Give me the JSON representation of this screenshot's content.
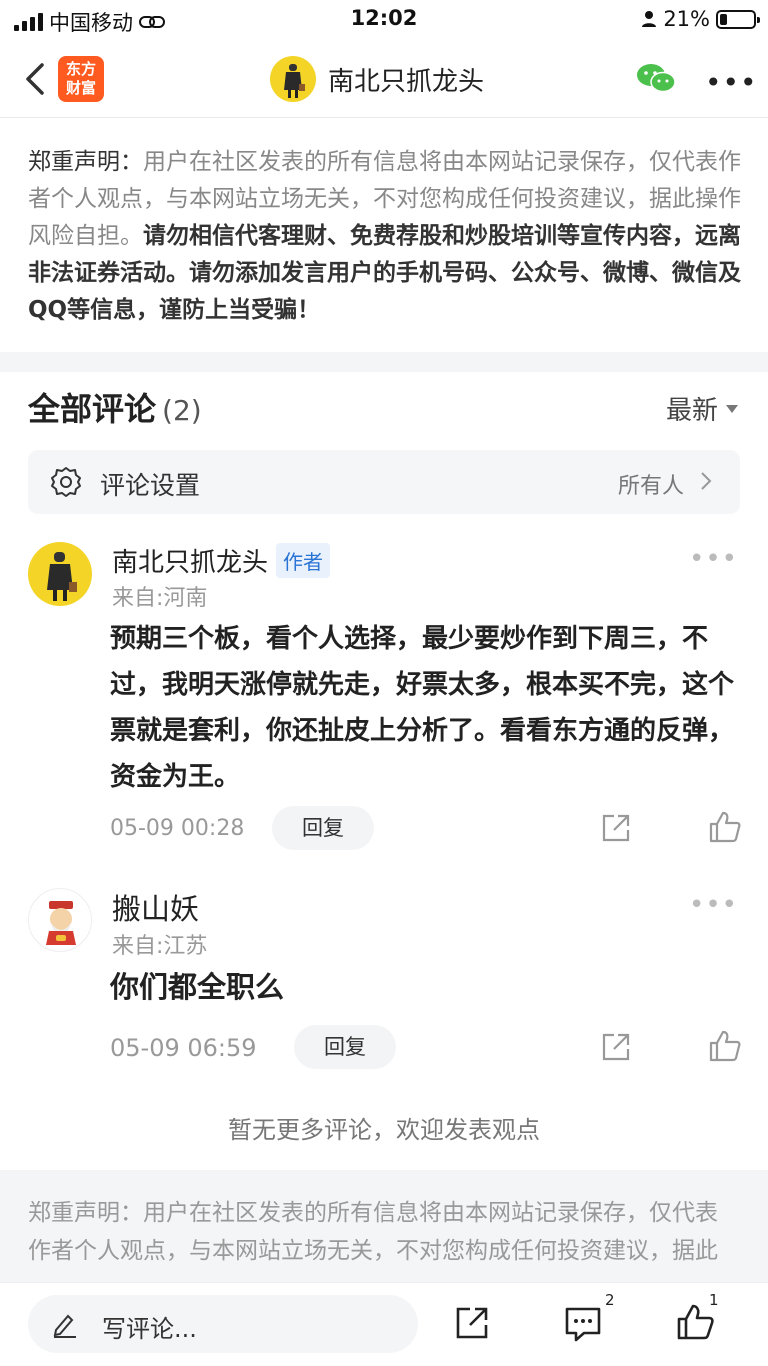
{
  "status_bar": {
    "carrier": "中国移动",
    "time": "12:02",
    "battery": "21%",
    "battery_level": 0.21
  },
  "nav": {
    "logo_line1": "东方",
    "logo_line2": "财富",
    "title": "南北只抓龙头"
  },
  "disclaimer_top": {
    "label": "郑重声明：",
    "gray": "用户在社区发表的所有信息将由本网站记录保存，仅代表作者个人观点，与本网站立场无关，不对您构成任何投资建议，据此操作风险自担。",
    "bold": "请勿相信代客理财、免费荐股和炒股培训等宣传内容，远离非法证券活动。请勿添加发言用户的手机号码、公众号、微博、微信及QQ等信息，谨防上当受骗！"
  },
  "comments_header": {
    "title": "全部评论",
    "count": "(2)",
    "sort": "最新"
  },
  "settings": {
    "label": "评论设置",
    "value": "所有人"
  },
  "comments": [
    {
      "name": "南北只抓龙头",
      "tag": "作者",
      "from": "来自:河南",
      "text": "预期三个板，看个人选择，最少要炒作到下周三，不过，我明天涨停就先走，好票太多，根本买不完，这个票就是套利，你还扯皮上分析了。看看东方通的反弹，资金为王。",
      "time": "05-09 00:28",
      "reply": "回复"
    },
    {
      "name": "搬山妖",
      "from": "来自:江苏",
      "text": "你们都全职么",
      "time": "05-09 06:59",
      "reply": "回复"
    }
  ],
  "end_note": "暂无更多评论，欢迎发表观点",
  "disclaimer_bottom": "郑重声明：用户在社区发表的所有信息将由本网站记录保存，仅代表作者个人观点，与本网站立场无关，不对您构成任何投资建议，据此操作风险自担。",
  "bottom_bar": {
    "placeholder": "写评论...",
    "comment_count": "2",
    "like_count": "1"
  }
}
